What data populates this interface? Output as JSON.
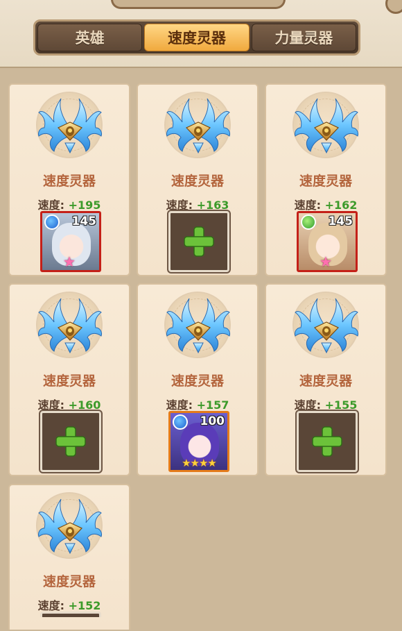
{
  "tabs": [
    {
      "label": "英雄",
      "active": false
    },
    {
      "label": "速度灵器",
      "active": true
    },
    {
      "label": "力量灵器",
      "active": false
    }
  ],
  "cards": [
    {
      "name": "速度灵器",
      "stat_label": "速度:",
      "stat_value": "+195",
      "slot": "hero",
      "hero_level": "145",
      "hero_element": "water-element-icon"
    },
    {
      "name": "速度灵器",
      "stat_label": "速度:",
      "stat_value": "+163",
      "slot": "empty"
    },
    {
      "name": "速度灵器",
      "stat_label": "速度:",
      "stat_value": "+162",
      "slot": "hero",
      "hero_level": "145",
      "hero_element": "wind-element-icon"
    },
    {
      "name": "速度灵器",
      "stat_label": "速度:",
      "stat_value": "+160",
      "slot": "empty"
    },
    {
      "name": "速度灵器",
      "stat_label": "速度:",
      "stat_value": "+157",
      "slot": "hero",
      "hero_level": "100",
      "hero_element": "water-element-icon",
      "hero_stars": "★★★★"
    },
    {
      "name": "速度灵器",
      "stat_label": "速度:",
      "stat_value": "+155",
      "slot": "empty"
    },
    {
      "name": "速度灵器",
      "stat_label": "速度:",
      "stat_value": "+152",
      "slot": "hidden"
    }
  ],
  "colors": {
    "stat_value": "#3c9a2a",
    "item_name": "#b4653d",
    "active_tab": "#f0a93e",
    "rarity_red": "#c42018",
    "rarity_orange": "#e47b1a"
  }
}
